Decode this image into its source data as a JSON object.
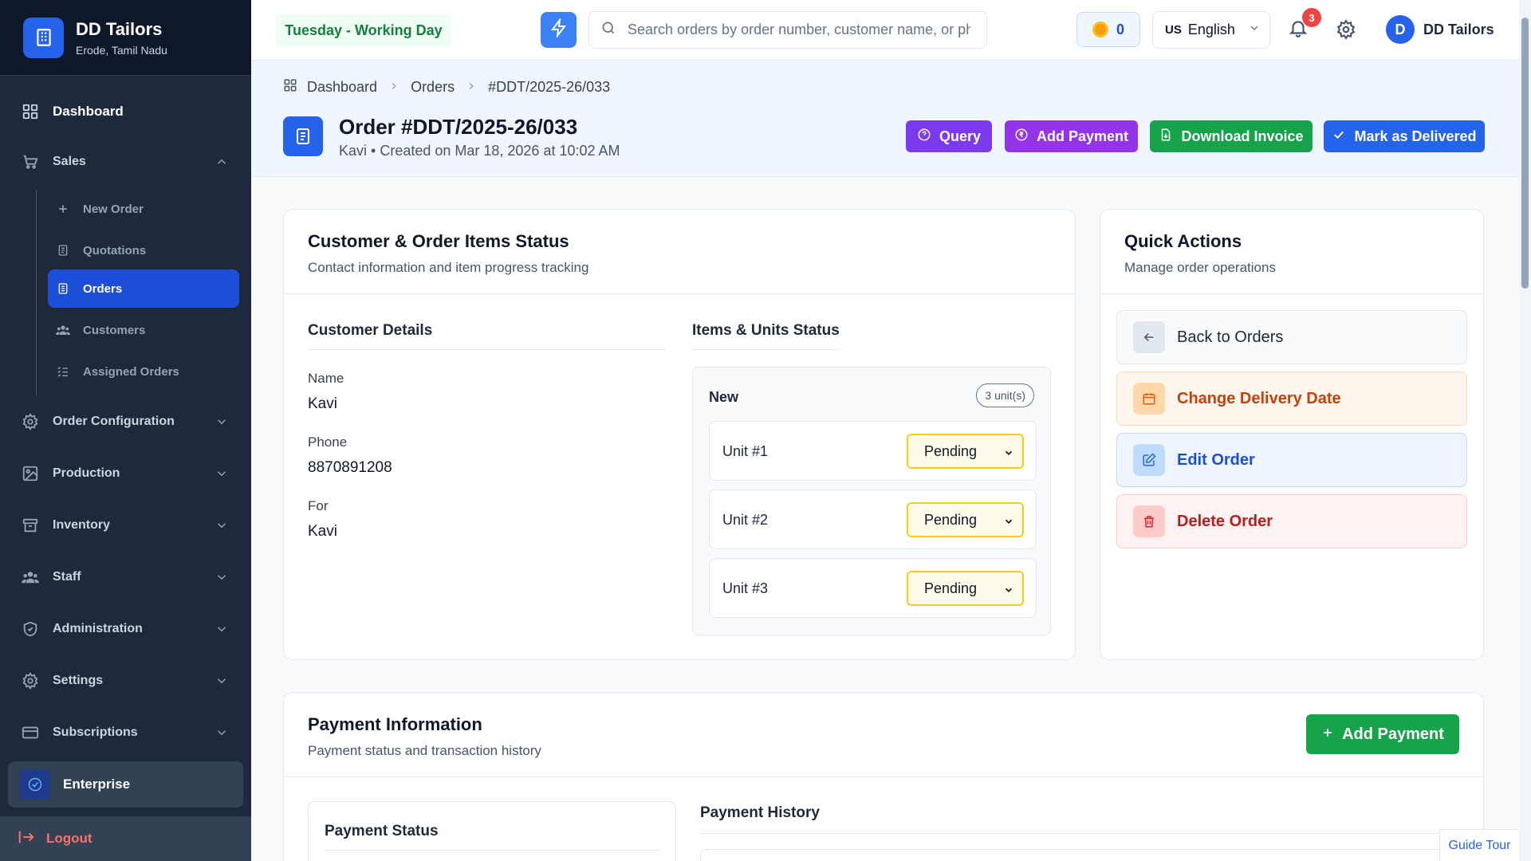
{
  "sidebar": {
    "brand_name": "DD Tailors",
    "brand_location": "Erode, Tamil Nadu",
    "dashboard": "Dashboard",
    "sales": "Sales",
    "sales_items": [
      "New Order",
      "Quotations",
      "Orders",
      "Customers",
      "Assigned Orders"
    ],
    "active_sub": "Orders",
    "sections": [
      "Order Configuration",
      "Production",
      "Inventory",
      "Staff",
      "Administration",
      "Settings",
      "Subscriptions"
    ],
    "plan": "Enterprise",
    "logout": "Logout"
  },
  "topbar": {
    "day_status": "Tuesday - Working Day",
    "search_placeholder": "Search orders by order number, customer name, or phone",
    "coins": "0",
    "lang_flag": "US",
    "language": "English",
    "notification_count": "3",
    "avatar_initial": "D",
    "user_name": "DD Tailors"
  },
  "header": {
    "breadcrumb": [
      "Dashboard",
      "Orders",
      "#DDT/2025-26/033"
    ],
    "title": "Order #DDT/2025-26/033",
    "subtitle": "Kavi • Created on Mar 18, 2026 at 10:02 AM",
    "buttons": {
      "query": "Query",
      "add_payment": "Add Payment",
      "download_invoice": "Download Invoice",
      "mark_delivered": "Mark as Delivered"
    }
  },
  "customer_card": {
    "title": "Customer & Order Items Status",
    "subtitle": "Contact information and item progress tracking",
    "details_title": "Customer Details",
    "name_label": "Name",
    "name": "Kavi",
    "phone_label": "Phone",
    "phone": "8870891208",
    "for_label": "For",
    "for": "Kavi",
    "items_title": "Items & Units Status",
    "group_name": "New",
    "units_count": "3 unit(s)",
    "units": [
      {
        "label": "Unit #1",
        "status": "Pending"
      },
      {
        "label": "Unit #2",
        "status": "Pending"
      },
      {
        "label": "Unit #3",
        "status": "Pending"
      }
    ]
  },
  "quick_actions": {
    "title": "Quick Actions",
    "subtitle": "Manage order operations",
    "back": "Back to Orders",
    "change_date": "Change Delivery Date",
    "edit": "Edit Order",
    "delete": "Delete Order"
  },
  "payment": {
    "title": "Payment Information",
    "subtitle": "Payment status and transaction history",
    "add_button": "Add Payment",
    "status_title": "Payment Status",
    "history_title": "Payment History"
  },
  "guide_tour": "Guide Tour"
}
